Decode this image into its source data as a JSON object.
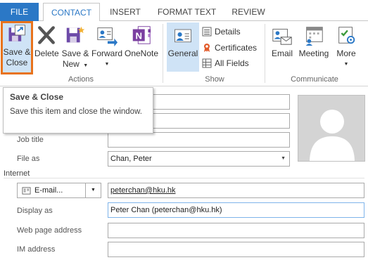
{
  "tabs": {
    "file": "FILE",
    "contact": "CONTACT",
    "insert": "INSERT",
    "format_text": "FORMAT TEXT",
    "review": "REVIEW"
  },
  "ribbon": {
    "actions": {
      "save_close_line1": "Save &",
      "save_close_line2": "Close",
      "delete": "Delete",
      "save_new_line1": "Save &",
      "save_new_line2": "New",
      "forward": "Forward",
      "onenote": "OneNote",
      "group_label": "Actions"
    },
    "show": {
      "general": "General",
      "details": "Details",
      "certificates": "Certificates",
      "all_fields": "All Fields",
      "group_label": "Show"
    },
    "communicate": {
      "email": "Email",
      "meeting": "Meeting",
      "more": "More",
      "group_label": "Communicate"
    }
  },
  "tooltip": {
    "title": "Save & Close",
    "body": "Save this item and close the window."
  },
  "form": {
    "job_title_label": "Job title",
    "job_title_value": "",
    "file_as_label": "File as",
    "file_as_value": "Chan, Peter",
    "internet_section": "Internet",
    "email_button": "E-mail...",
    "email_value": "peterchan@hku.hk",
    "display_as_label": "Display as",
    "display_as_value": "Peter Chan (peterchan@hku.hk)",
    "web_page_label": "Web page address",
    "web_page_value": "",
    "im_address_label": "IM address",
    "im_address_value": ""
  },
  "colors": {
    "file_tab": "#2b78c6",
    "accent_blue": "#2b78c6",
    "highlight_orange": "#e8731c",
    "selected_bg": "#cfe3f6"
  }
}
